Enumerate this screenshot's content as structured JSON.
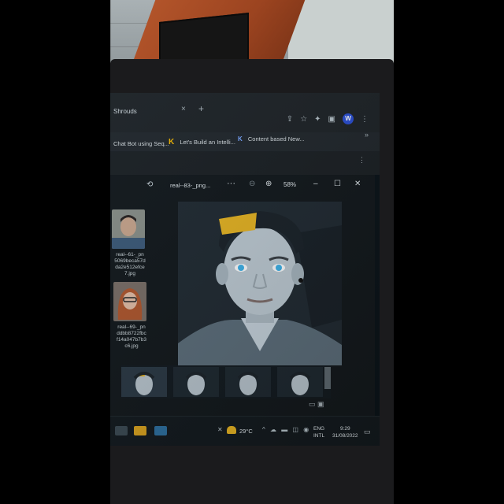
{
  "browser": {
    "tab_label": "Shrouds",
    "tab_close": "×",
    "tab_new": "+",
    "bookmarks": [
      {
        "label": "Chat Bot using Seq..."
      },
      {
        "label": "Let's Build an Intelli...",
        "logo": "K"
      },
      {
        "label": "Content based New...",
        "logo": "K"
      }
    ],
    "profile_initial": "W",
    "bookmarks_more": "»"
  },
  "photos_app": {
    "filename": "real--83-_png...",
    "zoom": "58%",
    "more": "···",
    "sidebar": [
      {
        "caption_lines": [
          "real--61-_pn",
          "5069beca57d",
          "da2e512efce",
          "7.jpg"
        ]
      },
      {
        "caption_lines": [
          "real--69-_pn",
          "ddbb8722fbc",
          "f14a047b7b3",
          "c6.jpg"
        ]
      }
    ]
  },
  "taskbar": {
    "temperature": "29°C",
    "language_line1": "ENG",
    "language_line2": "INTL",
    "time": "9:29",
    "date": "31/08/2022"
  },
  "colors": {
    "browser_profile": "#2c4fd3",
    "cap": "#e7b422"
  },
  "icons": [
    "close-icon",
    "plus-icon",
    "extensions-icon",
    "sidebar-icon",
    "more-vertical-icon",
    "kaggle-icon",
    "rotate-icon",
    "zoom-out-icon",
    "zoom-in-icon",
    "minimize-icon",
    "maximize-icon",
    "weather-icon",
    "notification-icon"
  ]
}
